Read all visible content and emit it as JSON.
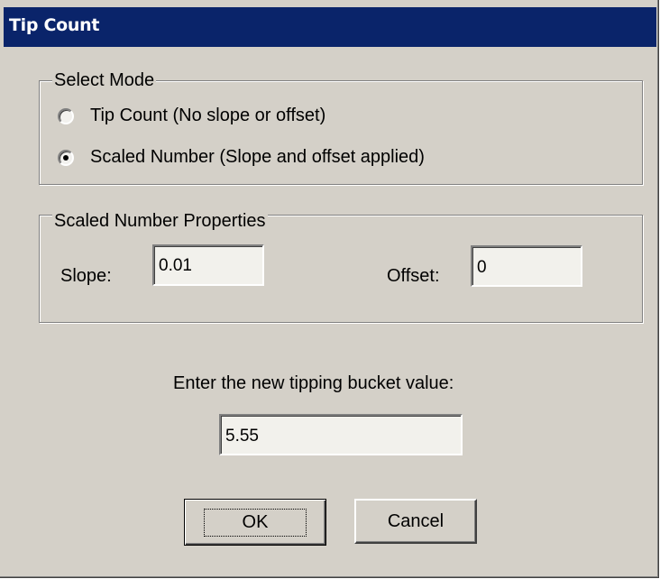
{
  "window": {
    "title": "Tip Count"
  },
  "select_mode": {
    "legend": "Select Mode",
    "options": [
      {
        "label": "Tip Count (No slope or offset)",
        "selected": false
      },
      {
        "label": "Scaled Number (Slope and offset applied)",
        "selected": true
      }
    ]
  },
  "scaled_props": {
    "legend": "Scaled Number Properties",
    "slope_label": "Slope:",
    "slope_value": "0.01",
    "offset_label": "Offset:",
    "offset_value": "0"
  },
  "bucket": {
    "prompt": "Enter the new tipping bucket value:",
    "value": "5.55"
  },
  "buttons": {
    "ok": "OK",
    "cancel": "Cancel"
  },
  "colors": {
    "titlebar": "#0a246a",
    "dialog_face": "#d4d0c8",
    "field_bg": "#f2f1ec"
  }
}
